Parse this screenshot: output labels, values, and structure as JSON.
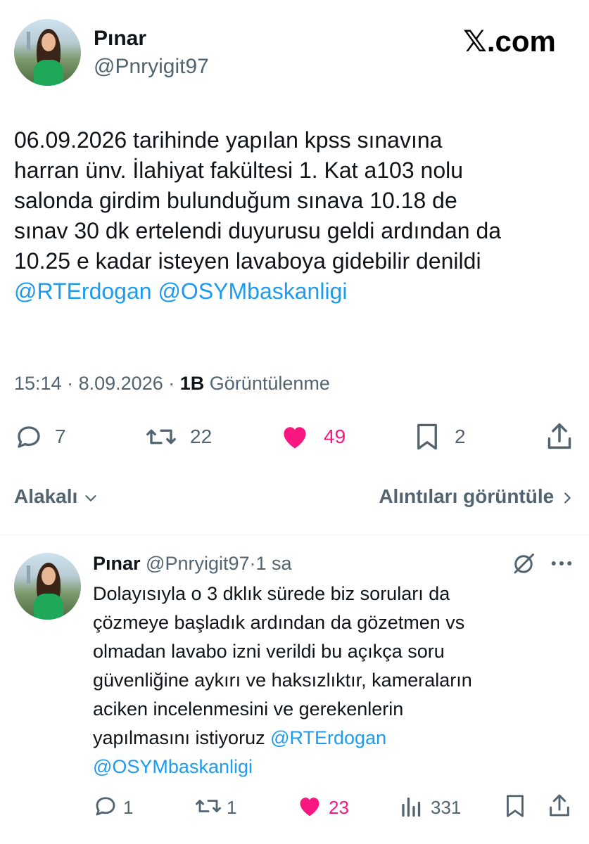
{
  "brand": {
    "logo_text": "𝕏.com"
  },
  "colors": {
    "link": "#1d9bf0",
    "like": "#f91880",
    "muted": "#536471",
    "text": "#0f1419"
  },
  "tweet": {
    "author_name": "Pınar",
    "author_handle": "@Pnryigit97",
    "text_lines": [
      "06.09.2026 tarihinde yapılan kpss sınavına",
      "harran ünv. İlahiyat fakültesi 1. Kat a103 nolu",
      "salonda girdim bulunduğum sınava 10.18 de",
      "sınav 30 dk ertelendi duyurusu geldi ardından da",
      "10.25 e kadar isteyen lavaboya gidebilir denildi"
    ],
    "mention_1": "@RTErdogan",
    "mention_2": "@OSYMbaskanligi",
    "time": "15:14",
    "sep": "·",
    "date": "8.09.2026",
    "views_count": "1B",
    "views_label": "Görüntülenme",
    "actions": {
      "replies": "7",
      "retweets": "22",
      "likes": "49",
      "bookmarks": "2"
    }
  },
  "filters": {
    "relevant_label": "Alakalı",
    "quotes_label": "Alıntıları görüntüle"
  },
  "reply": {
    "author_name": "Pınar",
    "author_handle": "@Pnryigit97",
    "sep": "·",
    "time": "1 sa",
    "text_lines": [
      "Dolayısıyla o 3 dklık sürede biz soruları da",
      "çözmeye başladık ardından da gözetmen vs",
      "olmadan lavabo izni verildi bu açıkça soru",
      "güvenliğine aykırı ve haksızlıktır, kameraların",
      "aciken incelenmesini ve gerekenlerin",
      "yapılmasını istiyoruz"
    ],
    "mention_1": "@RTErdogan",
    "mention_2": "@OSYMbaskanligi",
    "actions": {
      "replies": "1",
      "retweets": "",
      "likes": "23",
      "views": "331"
    }
  }
}
